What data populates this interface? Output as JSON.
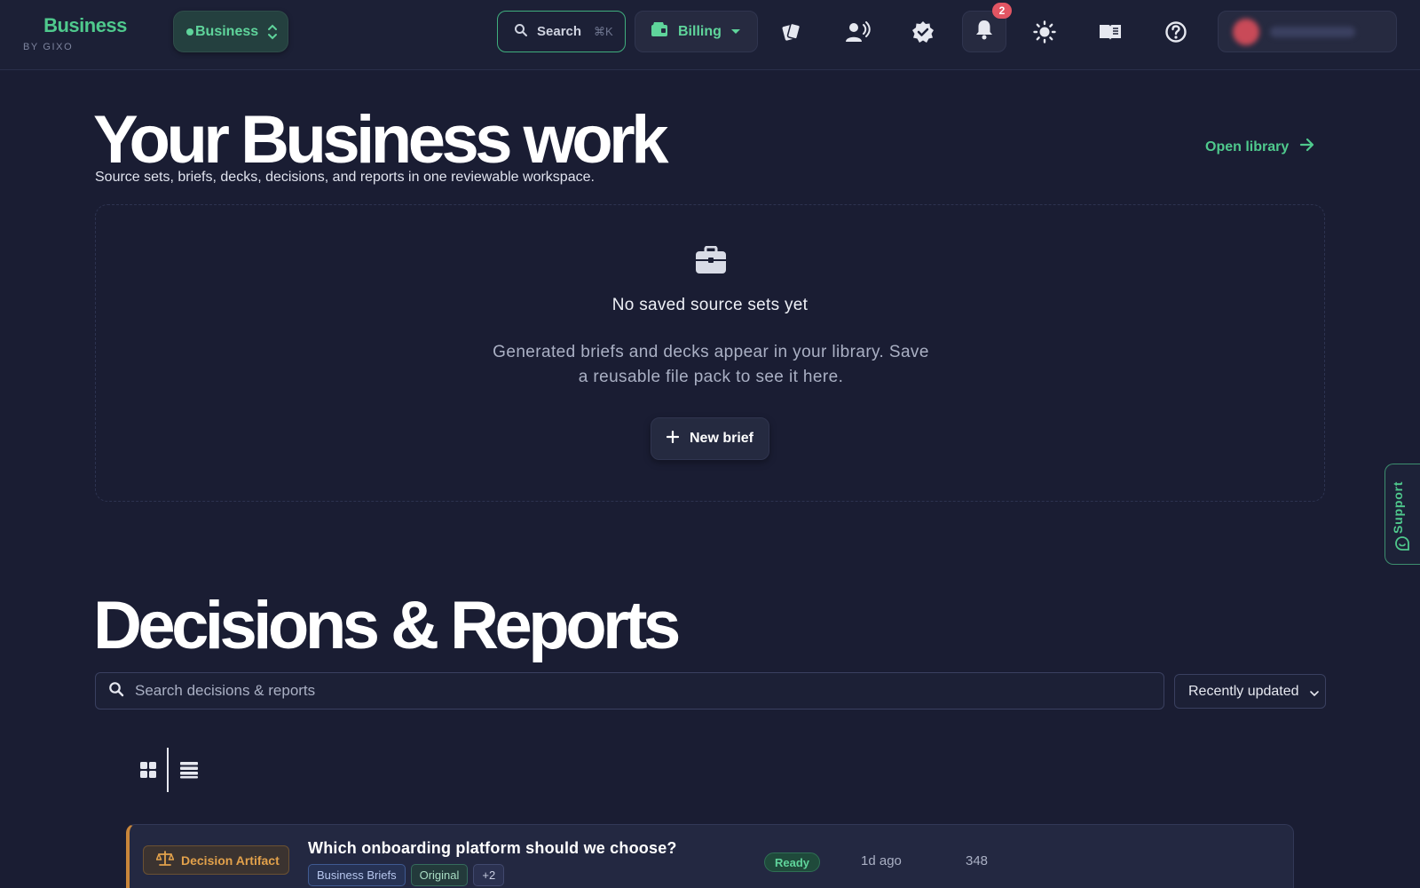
{
  "app": {
    "brand_title": "Business",
    "brand_subtitle": "BY GIXO",
    "workspace": "Business",
    "accent": "#4fc98d"
  },
  "toolbar": {
    "search_label": "Search",
    "search_shortcut": "⌘K",
    "billing_label": "Billing",
    "notifications_count": "2",
    "icons": [
      "cards-icon",
      "voice-user-icon",
      "verified-badge-icon",
      "bell-icon",
      "sun-icon",
      "book-icon",
      "help-icon"
    ]
  },
  "hero": {
    "title": "Your Business work",
    "subtitle": "Source sets, briefs, decks, decisions, and reports in one reviewable workspace.",
    "open_library": "Open library",
    "empty_title": "No saved source sets yet",
    "empty_body": "Generated briefs and decks appear in your library. Save a reusable file pack to see it here.",
    "new_brief": "New brief"
  },
  "support": {
    "label": "Support"
  },
  "decisions": {
    "title": "Decisions & Reports",
    "search_placeholder": "Search decisions & reports",
    "sort": "Recently updated",
    "rows": [
      {
        "type": "Decision Artifact",
        "title": "Which onboarding platform should we choose?",
        "tags": [
          "Business Briefs",
          "Original",
          "+2"
        ],
        "status": "Ready",
        "age": "1d ago",
        "count": "348"
      }
    ]
  }
}
